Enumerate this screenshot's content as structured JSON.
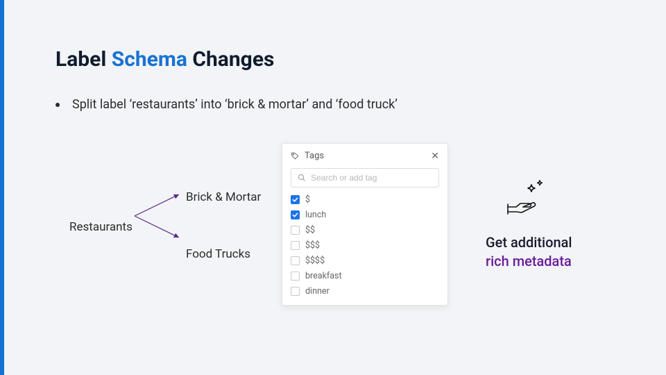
{
  "title": {
    "prefix": "Label ",
    "highlight": "Schema",
    "suffix": " Changes"
  },
  "bullet": "Split label ‘restaurants’ into ‘brick & mortar’ and ‘food truck’",
  "fork": {
    "root": "Restaurants",
    "branch_a": "Brick & Mortar",
    "branch_b": "Food Trucks"
  },
  "tags_panel": {
    "title": "Tags",
    "search_placeholder": "Search or add tag",
    "items": [
      {
        "label": "$",
        "checked": true
      },
      {
        "label": "lunch",
        "checked": true
      },
      {
        "label": "$$",
        "checked": false
      },
      {
        "label": "$$$",
        "checked": false
      },
      {
        "label": "$$$$",
        "checked": false
      },
      {
        "label": "breakfast",
        "checked": false
      },
      {
        "label": "dinner",
        "checked": false
      }
    ]
  },
  "callout": {
    "line1": "Get additional",
    "line2": "rich metadata"
  }
}
